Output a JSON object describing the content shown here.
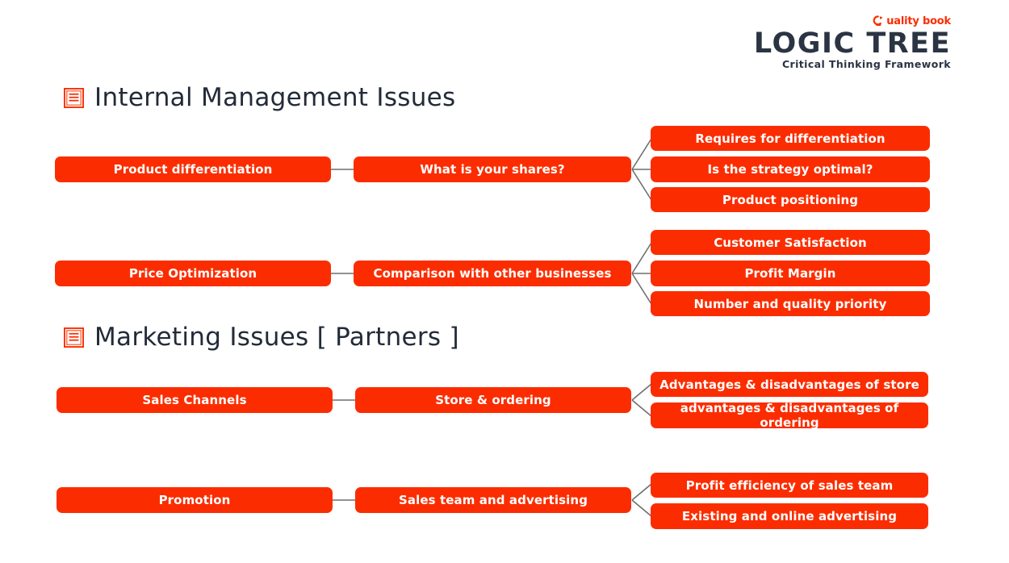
{
  "brand": {
    "qualitybook_icon": "q-logo-icon",
    "qualitybook_text": "uality book",
    "title": "LOGIC TREE",
    "subtitle": "Critical Thinking Framework",
    "accent_color": "#FB2D00",
    "title_color": "#2B3443"
  },
  "sections": [
    {
      "id": "internal-management-issues",
      "icon": "list-square-icon",
      "heading": "Internal Management Issues",
      "groups": [
        {
          "root": "Product differentiation",
          "branch": "What is your shares?",
          "leaves": [
            "Requires for differentiation",
            "Is the strategy optimal?",
            "Product positioning"
          ]
        },
        {
          "root": "Price Optimization",
          "branch": "Comparison with other businesses",
          "leaves": [
            "Customer Satisfaction",
            "Profit Margin",
            "Number and quality priority"
          ]
        }
      ]
    },
    {
      "id": "marketing-issues-partners",
      "icon": "list-square-icon",
      "heading": "Marketing Issues [ Partners ]",
      "groups": [
        {
          "root": "Sales Channels",
          "branch": "Store & ordering",
          "leaves": [
            "Advantages & disadvantages of store",
            "advantages & disadvantages of ordering"
          ]
        },
        {
          "root": "Promotion",
          "branch": "Sales team and advertising",
          "leaves": [
            "Profit efficiency of sales team",
            "Existing and online advertising"
          ]
        }
      ]
    }
  ],
  "colors": {
    "node_fill": "#FB2D00",
    "node_text": "#FFFFFF",
    "connector": "#6E6E6E",
    "heading_text": "#222B38",
    "background": "#FFFFFF"
  }
}
